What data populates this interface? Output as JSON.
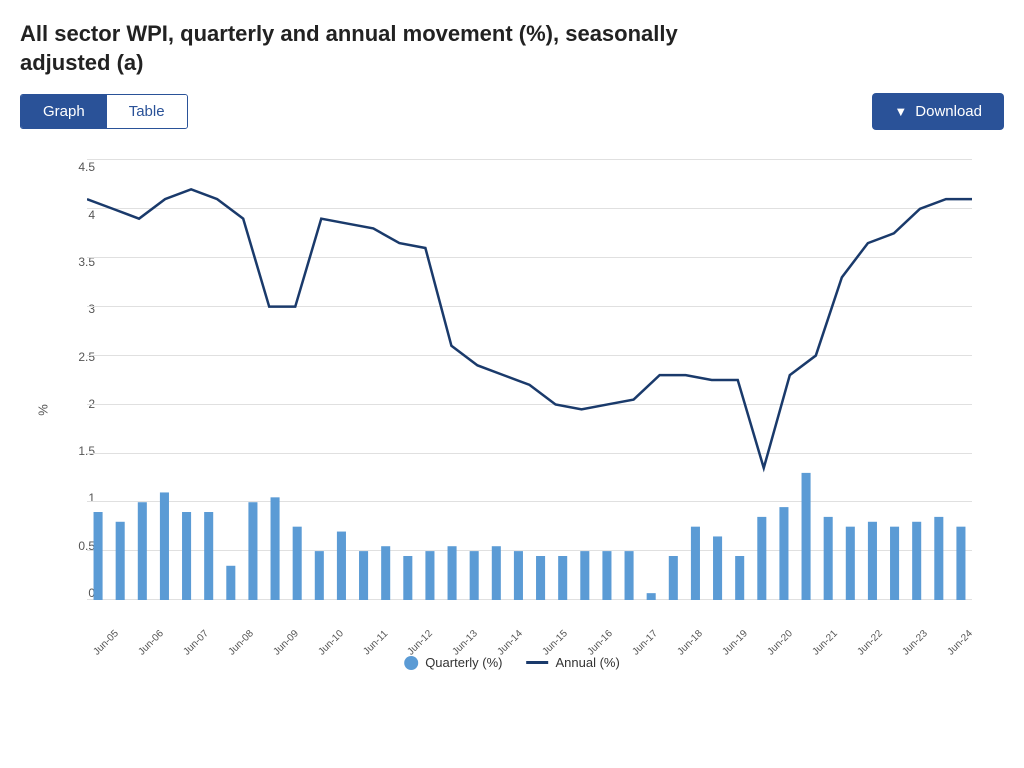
{
  "page": {
    "title": "All sector WPI, quarterly and annual movement (%), seasonally adjusted (a)",
    "tabs": [
      {
        "id": "graph",
        "label": "Graph",
        "active": true
      },
      {
        "id": "table",
        "label": "Table",
        "active": false
      }
    ],
    "download_button": "Download",
    "y_axis_label": "%",
    "y_ticks": [
      "0",
      "0.5",
      "1",
      "1.5",
      "2",
      "2.5",
      "3",
      "3.5",
      "4",
      "4.5"
    ],
    "x_ticks": [
      "Jun-05",
      "Jun-06",
      "Jun-07",
      "Jun-08",
      "Jun-09",
      "Jun-10",
      "Jun-11",
      "Jun-12",
      "Jun-13",
      "Jun-14",
      "Jun-15",
      "Jun-16",
      "Jun-17",
      "Jun-18",
      "Jun-19",
      "Jun-20",
      "Jun-21",
      "Jun-22",
      "Jun-23",
      "Jun-24"
    ],
    "legend": {
      "quarterly_label": "Quarterly (%)",
      "annual_label": "Annual (%)"
    },
    "colors": {
      "primary_blue": "#2a5298",
      "bar_blue": "#5b9bd5",
      "line_dark": "#1a3a6b",
      "grid": "#e0e0e0"
    },
    "quarterly_data": [
      0.9,
      0.8,
      1.0,
      1.1,
      0.9,
      0.9,
      0.35,
      1.0,
      1.05,
      0.75,
      0.5,
      0.7,
      0.5,
      0.55,
      0.45,
      0.5,
      0.55,
      0.5,
      0.55,
      0.5,
      0.45,
      0.45,
      0.5,
      0.5,
      0.5,
      0.07,
      0.45,
      0.75,
      0.65,
      0.45,
      0.85,
      0.95,
      1.3,
      0.85,
      0.75,
      0.8,
      0.75,
      0.8,
      0.85,
      0.75
    ],
    "annual_data": [
      4.1,
      4.0,
      3.9,
      4.1,
      4.2,
      4.1,
      3.9,
      3.0,
      3.0,
      3.9,
      3.85,
      3.8,
      3.65,
      3.6,
      2.6,
      2.4,
      2.3,
      2.2,
      2.0,
      1.95,
      2.0,
      2.05,
      2.3,
      2.3,
      2.25,
      2.25,
      1.35,
      2.3,
      2.5,
      3.3,
      3.65,
      3.75,
      4.0,
      4.1,
      4.1
    ]
  }
}
